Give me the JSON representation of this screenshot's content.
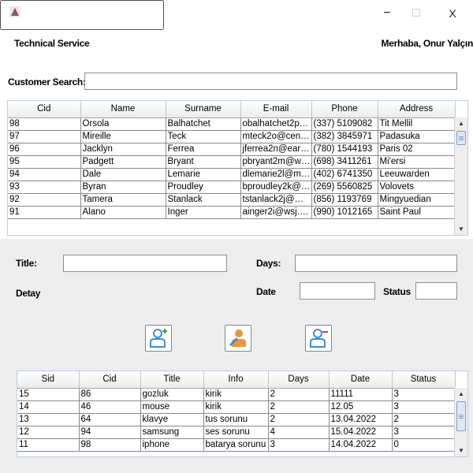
{
  "window": {
    "minimize_glyph": "−",
    "maximize_glyph": "☐",
    "close_glyph": "X"
  },
  "header": {
    "app_title": "Technical Service",
    "greeting": "Merhaba, Onur Yalçın"
  },
  "search": {
    "label": "Customer Search:",
    "value": ""
  },
  "customers": {
    "columns": [
      "Cid",
      "Name",
      "Surname",
      "E-mail",
      "Phone",
      "Address"
    ],
    "rows": [
      [
        "98",
        "Orsola",
        "Balhatchet",
        "obalhatchet2p@c...",
        "(337) 5109082",
        "Tit Mellil"
      ],
      [
        "97",
        "Mireille",
        "Teck",
        "mteck2o@census...",
        "(382) 3845971",
        "Padasuka"
      ],
      [
        "96",
        "Jacklyn",
        "Ferrea",
        "jferrea2n@earthli...",
        "(780) 1544193",
        "Paris 02"
      ],
      [
        "95",
        "Padgett",
        "Bryant",
        "pbryant2m@wsj.c...",
        "(698) 3411261",
        "Mi'ersi"
      ],
      [
        "94",
        "Dale",
        "Lemarie",
        "dlemarie2l@medi...",
        "(402) 6741350",
        "Leeuwarden"
      ],
      [
        "93",
        "Byran",
        "Proudley",
        "bproudley2k@typ...",
        "(269) 5560825",
        "Volovets"
      ],
      [
        "92",
        "Tamera",
        "Stanlack",
        "tstanlack2j@miitb...",
        "(856) 1193769",
        "Mingyuedian"
      ],
      [
        "91",
        "Alano",
        "Inger",
        "ainger2i@wsj.com",
        "(990) 1012165",
        "Saint Paul"
      ]
    ]
  },
  "form": {
    "title_label": "Title:",
    "days_label": "Days:",
    "detay_label": "Detay",
    "date_label": "Date",
    "status_label": "Status",
    "title_value": "",
    "days_value": "",
    "date_value": "",
    "status_value": "",
    "detay_value": ""
  },
  "buttons": {
    "add_icon": "user-add-icon",
    "edit_icon": "user-edit-icon",
    "remove_icon": "user-remove-icon"
  },
  "services": {
    "columns": [
      "Sid",
      "Cid",
      "Title",
      "Info",
      "Days",
      "Date",
      "Status"
    ],
    "rows": [
      [
        "15",
        "86",
        "gozluk",
        "kirik",
        "2",
        "11111",
        "3"
      ],
      [
        "14",
        "46",
        "mouse",
        "kirik",
        "2",
        "12.05",
        "3"
      ],
      [
        "13",
        "64",
        "klavye",
        "tus sorunu",
        "2",
        "13.04.2022",
        "2"
      ],
      [
        "12",
        "94",
        "samsung",
        "ses sorunu",
        "4",
        "15.04.2022",
        "3"
      ],
      [
        "11",
        "98",
        "iphone",
        "batarya sorunu",
        "3",
        "14.04.2022",
        "0"
      ]
    ]
  },
  "colors": {
    "accent": "#5b9bd5",
    "icon_add": "#3ba23b",
    "icon_edit": "#e08a2c",
    "icon_remove": "#d23a3a"
  }
}
